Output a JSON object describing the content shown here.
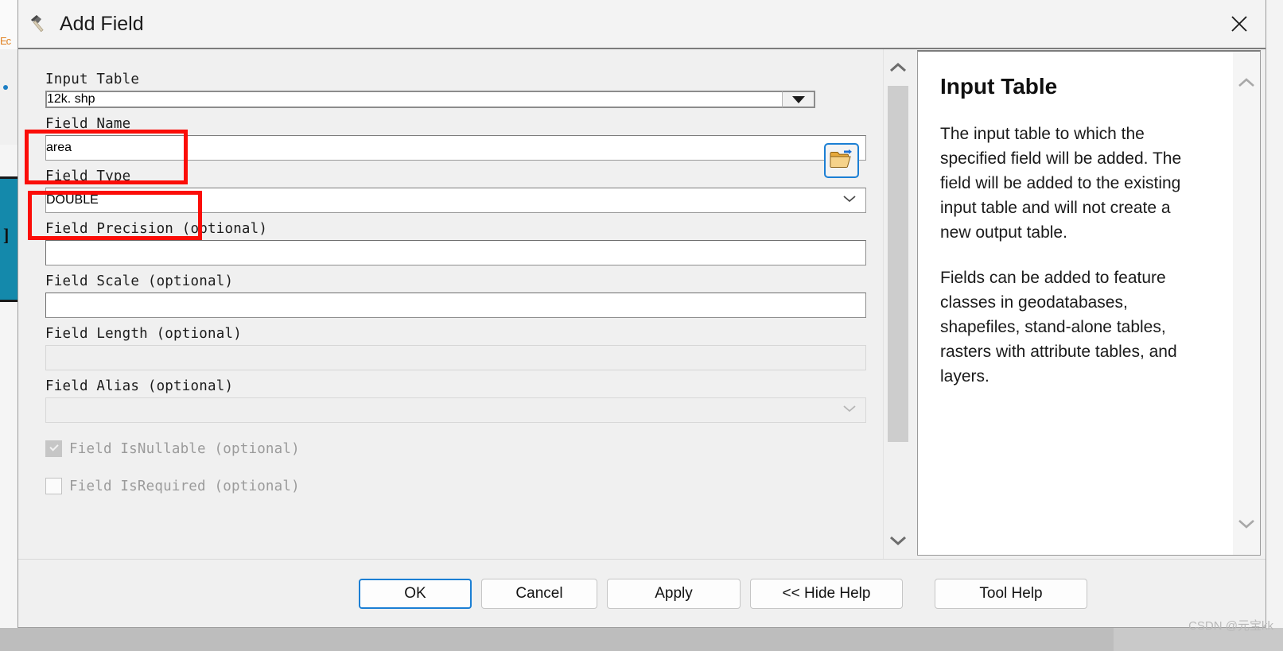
{
  "window": {
    "title": "Add Field",
    "icon": "hammer-tool-icon",
    "close_label": "✕"
  },
  "form": {
    "fields": [
      {
        "key": "input_table",
        "label": "Input Table",
        "value": "12k. shp",
        "control": "combobox-with-browse",
        "disabled": false
      },
      {
        "key": "field_name",
        "label": "Field Name",
        "value": "area",
        "control": "combobox",
        "disabled": false,
        "highlighted": true
      },
      {
        "key": "field_type",
        "label": "Field Type",
        "value": "DOUBLE",
        "control": "combobox",
        "disabled": false,
        "highlighted": true
      },
      {
        "key": "field_precision",
        "label": "Field Precision (optional)",
        "value": "",
        "control": "textbox",
        "disabled": false
      },
      {
        "key": "field_scale",
        "label": "Field Scale (optional)",
        "value": "",
        "control": "textbox",
        "disabled": false
      },
      {
        "key": "field_length",
        "label": "Field Length (optional)",
        "value": "",
        "control": "textbox",
        "disabled": true
      },
      {
        "key": "field_alias",
        "label": "Field Alias (optional)",
        "value": "",
        "control": "combobox",
        "disabled": true
      }
    ],
    "checkboxes": [
      {
        "key": "field_isnullable",
        "label": "Field IsNullable (optional)",
        "checked": true,
        "disabled": true
      },
      {
        "key": "field_isrequired",
        "label": "Field IsRequired (optional)",
        "checked": false,
        "disabled": true
      }
    ],
    "browse_button": {
      "icon": "open-folder-icon",
      "tooltip": "Browse"
    }
  },
  "help": {
    "title": "Input Table",
    "paragraphs": [
      "The input table to which the specified field will be added. The field will be added to the existing input table and will not create a new output table.",
      "Fields can be added to feature classes in geodatabases, shapefiles, stand-alone tables, rasters with attribute tables, and layers."
    ]
  },
  "footer": {
    "ok": "OK",
    "cancel": "Cancel",
    "apply": "Apply",
    "hide_help": "<< Hide Help",
    "tool_help": "Tool Help"
  },
  "scrollbars": {
    "form_up": "chevron-up-icon",
    "form_down": "chevron-down-icon",
    "help_up": "chevron-up-icon",
    "help_down": "chevron-down-icon"
  },
  "annotations": {
    "color": "#fb0d08",
    "boxes": [
      {
        "target": "field_name",
        "note": ""
      },
      {
        "target": "field_type",
        "note": ""
      }
    ]
  },
  "watermark": "CSDN @元宝kk",
  "backdrop": {
    "toc_label": "Ec",
    "accent_color": "#1489ab"
  }
}
